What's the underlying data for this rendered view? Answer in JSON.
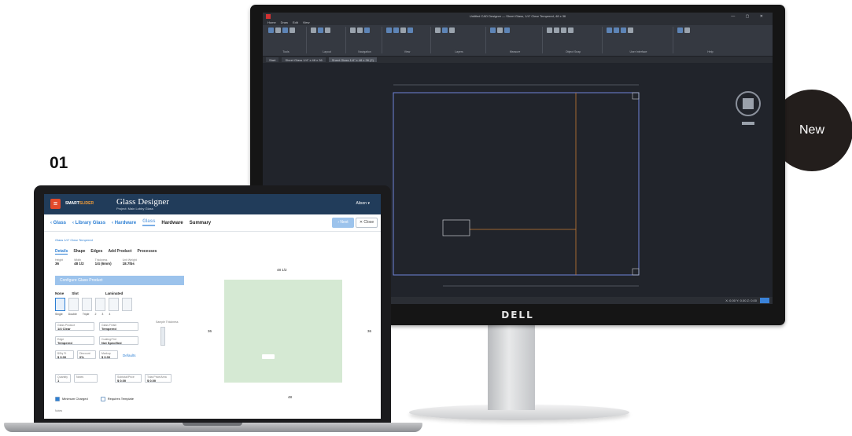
{
  "page": {
    "step_number": "01",
    "new_badge": "New"
  },
  "monitor": {
    "brand": "DELL",
    "cad": {
      "title": "Untitled CAD Designer — Sheet Glass, 1/4\" Clear Tempered, 48 x 36",
      "menu": [
        "Home",
        "Draw",
        "Edit",
        "View"
      ],
      "ribbon_groups": [
        "Tools",
        "Layout",
        "Navigation",
        "View",
        "Layers",
        "Measure",
        "Object Snap",
        "User Interface",
        "Help"
      ],
      "tabs": [
        "Start",
        "Sheet Glass 1/4\" x 48 x 36",
        "Sheet Glass 1/4\" x 48 x 36 (2)"
      ],
      "status": "X: 0.00  Y: 0.00  Z: 0.00"
    }
  },
  "laptop": {
    "header": {
      "logo_main": "SMART",
      "logo_accent": "SLIDER",
      "app_title": "Glass Designer",
      "app_subtitle": "Project: Main Lobby Glass",
      "user": "Alison"
    },
    "nav": {
      "steps": [
        "‹ Glass",
        "‹ Library Glass",
        "‹ Hardware",
        "Glass",
        "Hardware",
        "Summary"
      ],
      "next_label": "› Next",
      "close_label": "✕ Close"
    },
    "breadcrumb": "Glass 1/4\" Clear Tempered",
    "subtabs": [
      "Details",
      "Shape",
      "Edges",
      "Add Product",
      "Processes"
    ],
    "fields": [
      {
        "label": "Height",
        "value": "36"
      },
      {
        "label": "Width",
        "value": "48 1/2"
      },
      {
        "label": "Thickness",
        "value": "1/4 (6mm)"
      },
      {
        "label": "Unit Weight",
        "value": "18.7lbs"
      }
    ],
    "panel_title": "Configure Glass Product",
    "option_row_labels": [
      "None",
      "Slot",
      "Laminated"
    ],
    "option_captions": [
      "Single",
      "Double",
      "Triple",
      "2",
      "3",
      "4"
    ],
    "form": {
      "glass_type": {
        "label": "Glass Product",
        "value": "1/4 Clear"
      },
      "finish": {
        "label": "Glass Finish",
        "value": "Tempered"
      },
      "edge": {
        "label": "Edge",
        "value": "Tempered"
      },
      "coating": {
        "label": "Coating/Tint",
        "value": "Not Specified"
      },
      "price_sqft": {
        "label": "$/Sq Ft",
        "value": "$ 0.00"
      },
      "discount": {
        "label": "Discount",
        "value": "0%"
      },
      "markup": {
        "label": "Markup",
        "value": "$ 0.00"
      },
      "defaults": "Defaults",
      "quantity": {
        "label": "Quantity",
        "value": "1"
      },
      "notes_label": "Notes",
      "subtotal": {
        "label": "Subtotal/Price",
        "value": "$ 0.00"
      },
      "total": {
        "label": "Total Price/Area",
        "value": "$ 0.00"
      },
      "sample_thickness": "Sample Thickness"
    },
    "dimensions": {
      "top": "48 1/2",
      "left": "36",
      "right": "36",
      "bottom": "48"
    },
    "checkboxes": [
      {
        "label": "Minimum Charged",
        "checked": true
      },
      {
        "label": "Requires Template",
        "checked": false
      }
    ],
    "notes": "Notes"
  }
}
